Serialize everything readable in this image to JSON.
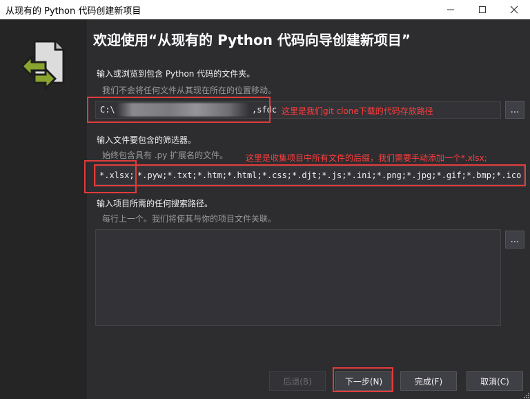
{
  "window": {
    "title": "从现有的 Python 代码创建新项目"
  },
  "heading": "欢迎使用“从现有的 Python 代码向导创建新项目”",
  "folder_section": {
    "label": "输入或浏览到包含 Python 代码的文件夹。",
    "hint": "我们不会将任何文件从其现在所在的位置移动。",
    "value_prefix": "C:\\",
    "value_suffix": ",sfdc",
    "annotation": "这里是我们git clone下载的代码存放路径",
    "browse_label": "..."
  },
  "filter_section": {
    "label": "输入文件要包含的筛选器。",
    "hint": "始终包含具有 .py 扩展名的文件。",
    "annotation": "这里是收集项目中所有文件的后缀，我们需要手动添加一个*.xlsx;",
    "highlighted_prefix": "*.xlsx;",
    "value_rest": "*.pyw;*.txt;*.htm;*.html;*.css;*.djt;*.js;*.ini;*.png;*.jpg;*.gif;*.bmp;*.ico"
  },
  "search_section": {
    "label": "输入项目所需的任何搜索路径。",
    "hint": "每行上一个。我们将使其与你的项目文件关联。",
    "value": "",
    "browse_label": "..."
  },
  "buttons": {
    "back": "后退(B)",
    "next": "下一步(N)",
    "finish": "完成(F)",
    "cancel": "取消(C)"
  },
  "colors": {
    "background": "#2d2d30",
    "sidebar": "#252526",
    "field": "#333337",
    "annotation": "#e23b3b",
    "logo_green": "#8aa52f"
  },
  "icons": [
    "minimize-icon",
    "maximize-icon",
    "close-icon",
    "python-project-logo-icon",
    "resize-grip-icon"
  ]
}
